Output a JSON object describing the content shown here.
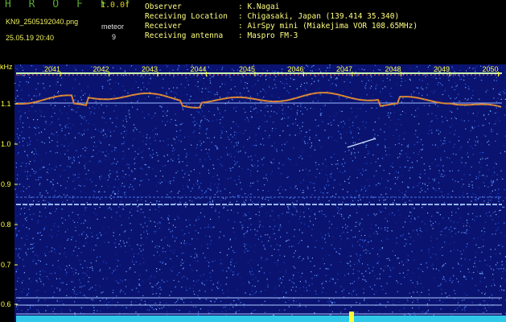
{
  "header": {
    "app_name": "H R O F F T",
    "version": "1.0.0f",
    "file": "KN9_2505192040.png",
    "datetime": "25.05.19 20:40",
    "meteor_label": "meteor",
    "meteor_count": "9",
    "info": [
      {
        "label": "Observer",
        "value": ": K.Nagai"
      },
      {
        "label": "Receiving Location",
        "value": ": Chigasaki, Japan (139.414 35.340)"
      },
      {
        "label": "Receiver",
        "value": ": AirSpy mini (Miakejima VOR 108.65MHz)"
      },
      {
        "label": "Receiving antenna",
        "value": ": Maspro FM-3"
      }
    ]
  },
  "plot": {
    "y_unit": "kHz",
    "y_ticks": [
      "1.1",
      "1.0",
      "0.9",
      "0.8",
      "0.7",
      "0.6"
    ],
    "x_ticks": [
      "2041",
      "2042",
      "2043",
      "2044",
      "2045",
      "2046",
      "2047",
      "2048",
      "2049",
      "2050"
    ],
    "colors": {
      "background": "#0a1470",
      "tick_text": "#ffff40",
      "trace": "#e87a30",
      "carrier_line": "#9ab8ff"
    }
  }
}
